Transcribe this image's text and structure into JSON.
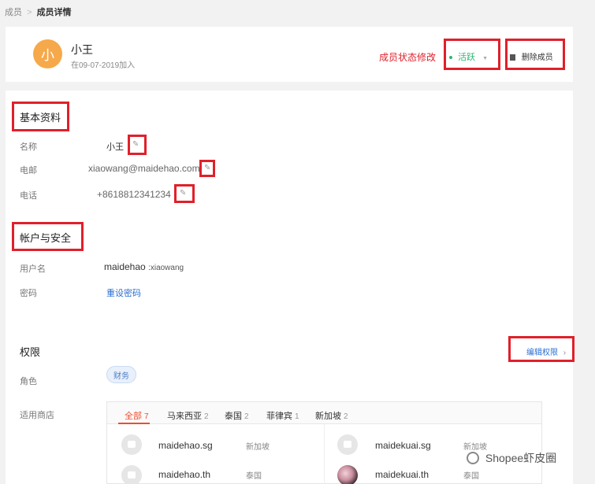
{
  "breadcrumb": {
    "parent": "成员",
    "separator": ">",
    "current": "成员详情"
  },
  "member": {
    "avatar_letter": "小",
    "name": "小王",
    "joined": "在09-07-2019加入",
    "status_annotation": "成员状态修改",
    "status": "活跃",
    "delete_label": "删除成员"
  },
  "basic_info": {
    "title": "基本资料",
    "fields": [
      {
        "label": "名称",
        "value": "小王"
      },
      {
        "label": "电邮",
        "value": "xiaowang@maidehao.com"
      },
      {
        "label": "电话",
        "value": "+8618812341234"
      }
    ]
  },
  "account": {
    "title": "帐户与安全",
    "username_label": "用户名",
    "username_main": "maidehao",
    "username_sub": ":xiaowang",
    "password_label": "密码",
    "reset_password": "重设密码"
  },
  "permissions": {
    "title": "权限",
    "edit_label": "编辑权限",
    "role_label": "角色",
    "role_value": "财务",
    "shops_label": "适用商店",
    "tabs": [
      {
        "label": "全部",
        "count": "7"
      },
      {
        "label": "马来西亚",
        "count": "2"
      },
      {
        "label": "泰国",
        "count": "2"
      },
      {
        "label": "菲律宾",
        "count": "1"
      },
      {
        "label": "新加坡",
        "count": "2"
      }
    ],
    "shops": [
      {
        "name": "maidehao.sg",
        "country": "新加坡"
      },
      {
        "name": "maidekuai.sg",
        "country": "新加坡"
      },
      {
        "name": "maidehao.th",
        "country": "泰国"
      },
      {
        "name": "maidekuai.th",
        "country": "泰国"
      }
    ]
  },
  "watermark": "Shopee虾皮圈",
  "colors": {
    "accent": "#ee4d2d",
    "annotation": "#e0202a",
    "active": "#2eb872",
    "link": "#2b6fd3"
  }
}
